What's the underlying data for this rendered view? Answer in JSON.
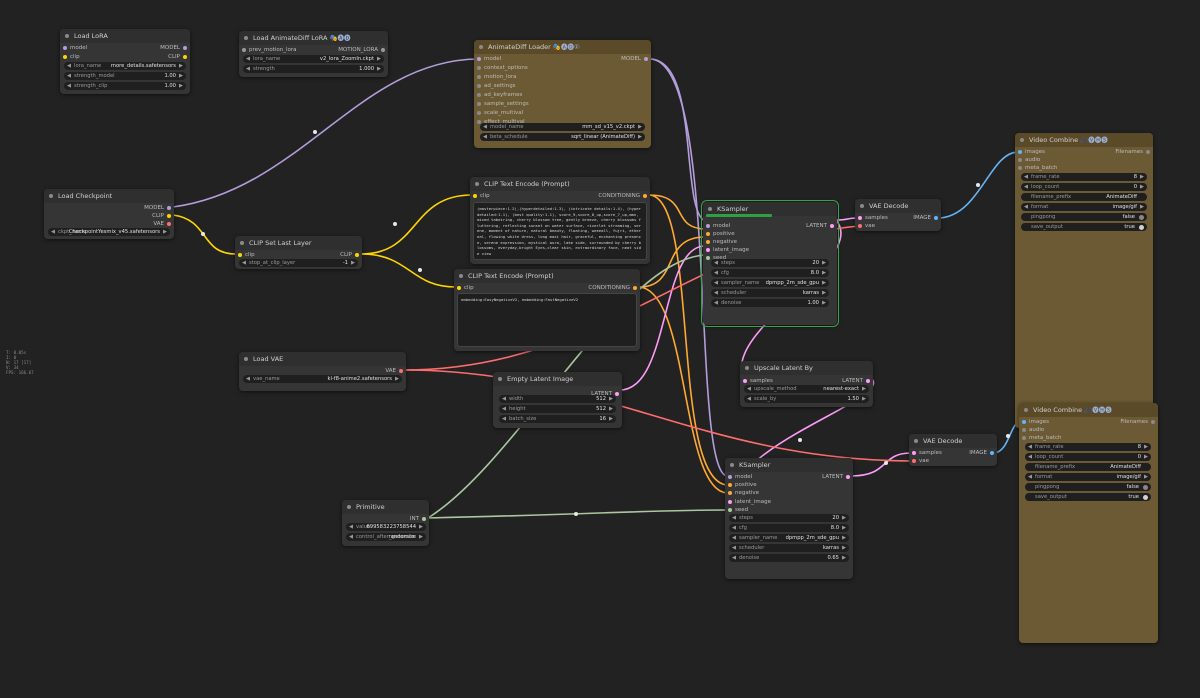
{
  "colors": {
    "background": "#222222",
    "node": "#353535",
    "node_gold": "#6b5a33",
    "model_wire": "#b39ddb",
    "clip_wire": "#ffd500",
    "conditioning_wire": "#ffa931",
    "latent_wire": "#ff9cf9",
    "vae_wire": "#ff6e6e",
    "image_wire": "#64b5f6",
    "int_wire": "#aac7a0",
    "ksampler_border": "#3aa34a"
  },
  "stats": [
    "T: 0.05s",
    "I: 0",
    "N: 17 [17]",
    "V: 34",
    "FPS: 166.67"
  ],
  "load_lora": {
    "title": "Load LoRA",
    "in_model": "model",
    "in_clip": "clip",
    "out_model": "MODEL",
    "out_clip": "CLIP",
    "lora_name_label": "lora_name",
    "lora_name": "more_details.safetensors",
    "strength_model_label": "strength_model",
    "strength_model": "1.00",
    "strength_clip_label": "strength_clip",
    "strength_clip": "1.00"
  },
  "animatediff_lora": {
    "title": "Load AnimateDiff LoRA",
    "tag": "🎭🅐🅓",
    "in_prev": "prev_motion_lora",
    "out_motion": "MOTION_LORA",
    "lora_name_label": "lora_name",
    "lora_name": "v2_lora_ZoomIn.ckpt",
    "strength_label": "strength",
    "strength": "1.000"
  },
  "animatediff_loader": {
    "title": "AnimateDiff Loader",
    "tag": "🎭🅐🅓①",
    "inputs": [
      "model",
      "context_options",
      "motion_lora",
      "ad_settings",
      "ad_keyframes",
      "sample_settings",
      "scale_multival",
      "effect_multival"
    ],
    "out_model": "MODEL",
    "model_name_label": "model_name",
    "model_name": "mm_sd_v15_v2.ckpt",
    "beta_schedule_label": "beta_schedule",
    "beta_schedule": "sqrt_linear (AnimateDiff)"
  },
  "load_checkpoint": {
    "title": "Load Checkpoint",
    "out_model": "MODEL",
    "out_clip": "CLIP",
    "out_vae": "VAE",
    "ckpt_name_label": "ckpt_name",
    "ckpt_name": "CheckpointYesmix_v45.safetensors"
  },
  "clip_set_last_layer": {
    "title": "CLIP Set Last Layer",
    "in_clip": "clip",
    "out_clip": "CLIP",
    "stop_label": "stop_at_clip_layer",
    "stop": "-1"
  },
  "clip_pos": {
    "title": "CLIP Text Encode (Prompt)",
    "in_clip": "clip",
    "out": "CONDITIONING",
    "text": "(masterpiece:1.2),(hyperdetailed:1.3), (intricate details:1.4), (hyperdetailed:1.1), (best quality:1.1), score_9,score_8_up,score_7_up,mmn, mixed tabeiring, cherry blossom tree, gently breeze, cherry blossoms fluttering, reflecting sunset on water surface, riverlet streaming, serene, moment of nature, natural beauty, floating, weeeall, fujri, ethereal, flowing white dress, long maxi hair, graceful, enchanting presence, serene expression, mystical aura, lake side, surrounded by cherry blossoms, everyday,bright Eyes,clear skin, extraordinary face, neat side view"
  },
  "clip_neg": {
    "title": "CLIP Text Encode (Prompt)",
    "in_clip": "clip",
    "out": "CONDITIONING",
    "text": "embedding:EasyNegativeV2, embedding:FastNegativeV2"
  },
  "ksampler1": {
    "title": "KSampler",
    "inputs": [
      "model",
      "positive",
      "negative",
      "latent_image",
      "seed"
    ],
    "out": "LATENT",
    "steps_label": "steps",
    "steps": "20",
    "cfg_label": "cfg",
    "cfg": "8.0",
    "sampler_label": "sampler_name",
    "sampler": "dpmpp_2m_sde_gpu",
    "scheduler_label": "scheduler",
    "scheduler": "karras",
    "denoise_label": "denoise",
    "denoise": "1.00",
    "progress": 1.0
  },
  "vae_decode1": {
    "title": "VAE Decode",
    "in_samples": "samples",
    "in_vae": "vae",
    "out": "IMAGE"
  },
  "video1": {
    "title": "Video Combine",
    "tag": "🎥🅥🅗🅢",
    "in_images": "images",
    "in_audio": "audio",
    "in_meta": "meta_batch",
    "out": "Filenames",
    "frame_rate_label": "frame_rate",
    "frame_rate": "8",
    "loop_count_label": "loop_count",
    "loop_count": "0",
    "prefix_label": "filename_prefix",
    "prefix": "AnimateDiff",
    "format_label": "format",
    "format": "image/gif",
    "pingpong_label": "pingpong",
    "pingpong": "false",
    "save_label": "save_output",
    "save": "true"
  },
  "load_vae": {
    "title": "Load VAE",
    "out": "VAE",
    "vae_name_label": "vae_name",
    "vae_name": "kl-f8-anime2.safetensors"
  },
  "empty_latent": {
    "title": "Empty Latent Image",
    "out": "LATENT",
    "width_label": "width",
    "width": "512",
    "height_label": "height",
    "height": "512",
    "batch_label": "batch_size",
    "batch": "16"
  },
  "upscale": {
    "title": "Upscale Latent By",
    "in_samples": "samples",
    "out": "LATENT",
    "method_label": "upscale_method",
    "method": "nearest-exact",
    "scale_label": "scale_by",
    "scale": "1.50"
  },
  "primitive": {
    "title": "Primitive",
    "out": "INT",
    "value_label": "value",
    "value": "699583223758544",
    "control_label": "control_after_generate",
    "control": "randomize"
  },
  "ksampler2": {
    "title": "KSampler",
    "inputs": [
      "model",
      "positive",
      "negative",
      "latent_image",
      "seed"
    ],
    "out": "LATENT",
    "steps_label": "steps",
    "steps": "20",
    "cfg_label": "cfg",
    "cfg": "8.0",
    "sampler_label": "sampler_name",
    "sampler": "dpmpp_2m_sde_gpu",
    "scheduler_label": "scheduler",
    "scheduler": "karras",
    "denoise_label": "denoise",
    "denoise": "0.65"
  },
  "vae_decode2": {
    "title": "VAE Decode",
    "in_samples": "samples",
    "in_vae": "vae",
    "out": "IMAGE"
  },
  "video2": {
    "title": "Video Combine",
    "tag": "🎥🅥🅗🅢",
    "in_images": "images",
    "in_audio": "audio",
    "in_meta": "meta_batch",
    "out": "Filenames",
    "frame_rate_label": "frame_rate",
    "frame_rate": "8",
    "loop_count_label": "loop_count",
    "loop_count": "0",
    "prefix_label": "filename_prefix",
    "prefix": "AnimateDiff",
    "format_label": "format",
    "format": "image/gif",
    "pingpong_label": "pingpong",
    "pingpong": "false",
    "save_label": "save_output",
    "save": "true"
  }
}
